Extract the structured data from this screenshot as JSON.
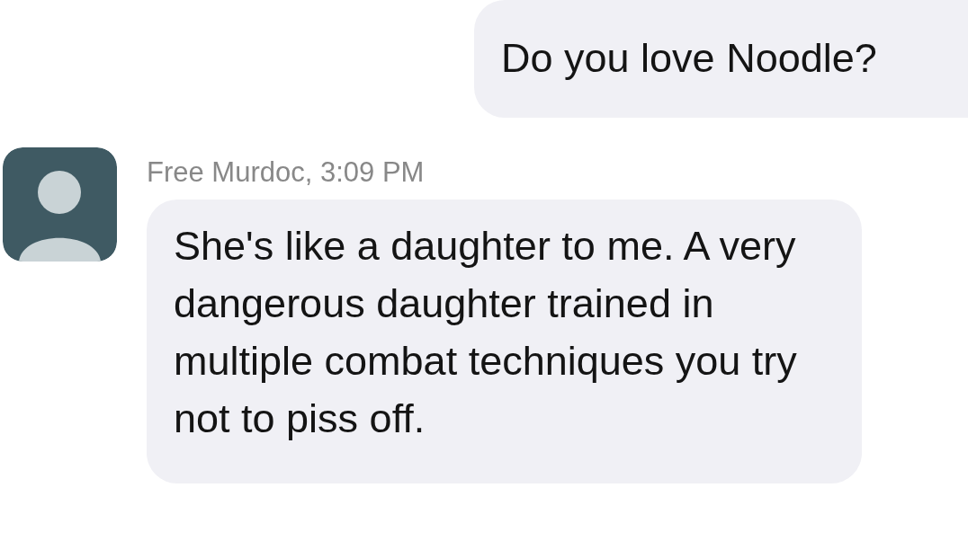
{
  "messages": [
    {
      "kind": "sent",
      "text": "Do you love Noodle?"
    },
    {
      "kind": "received",
      "sender": "Free Murdoc, 3:09 PM",
      "text": "She's like a daughter to me. A very dangerous daughter trained in multiple combat techniques you try not to piss off."
    }
  ]
}
